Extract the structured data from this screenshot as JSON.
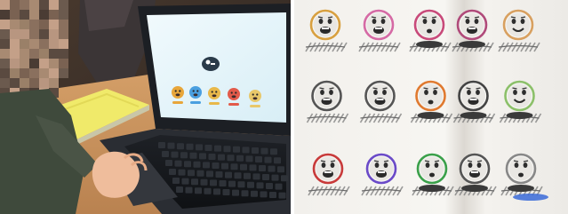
{
  "left_photo": {
    "screen_emojis": [
      {
        "icon": "very-happy-face-icon",
        "color": "#e8a63a"
      },
      {
        "icon": "happy-face-icon",
        "color": "#4a9fe0"
      },
      {
        "icon": "neutral-face-icon",
        "color": "#e8b84a"
      },
      {
        "icon": "sad-face-icon",
        "color": "#e25a4a"
      },
      {
        "icon": "very-sad-face-icon",
        "color": "#e8c86a"
      }
    ],
    "screen_color": "#e8f6fb",
    "laptop_color": "#22252b"
  },
  "right_photo": {
    "rows": [
      [
        {
          "ring": "#d8a040",
          "mouth": "open",
          "label": false
        },
        {
          "ring": "#d56aa5",
          "mouth": "open",
          "label": false
        },
        {
          "ring": "#c84a7a",
          "mouth": "small",
          "label": true
        },
        {
          "ring": "#b04a7a",
          "mouth": "open",
          "label": true
        },
        {
          "ring": "#d8a060",
          "mouth": "smile",
          "label": false
        }
      ],
      [
        {
          "ring": "#555555",
          "mouth": "open",
          "label": false
        },
        {
          "ring": "#555555",
          "mouth": "open",
          "label": false
        },
        {
          "ring": "#e07a30",
          "mouth": "small",
          "label": true
        },
        {
          "ring": "#444444",
          "mouth": "open",
          "label": true
        },
        {
          "ring": "#8cc06a",
          "mouth": "smile",
          "label": true
        }
      ],
      [
        {
          "ring": "#c83a3a",
          "mouth": "open",
          "label": false
        },
        {
          "ring": "#6a4ac8",
          "mouth": "open",
          "label": false
        },
        {
          "ring": "#3aa04a",
          "mouth": "small",
          "label": true
        },
        {
          "ring": "#555555",
          "mouth": "open",
          "label": true
        },
        {
          "ring": "#888888",
          "mouth": "small",
          "label": true
        }
      ]
    ]
  }
}
